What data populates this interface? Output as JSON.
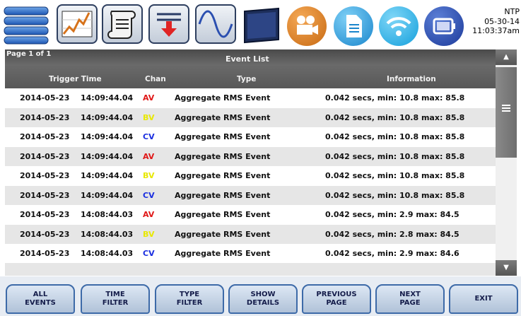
{
  "ntp": {
    "label": "NTP",
    "date": "05-30-14",
    "time": "11:03:37am"
  },
  "toolbar": {
    "icons": [
      "menu-icon",
      "trend-chart-icon",
      "scroll-log-icon",
      "download-icon",
      "waveform-icon",
      "screen-icon",
      "video-camera-icon",
      "document-icon",
      "wireless-icon",
      "battery-icon"
    ]
  },
  "list": {
    "page": "Page 1 of 1",
    "title": "Event List",
    "columns": {
      "trigger_time": "Trigger Time",
      "chan": "Chan",
      "type": "Type",
      "information": "Information"
    },
    "rows": [
      {
        "date": "2014-05-23",
        "time": "14:09:44.04",
        "chan": "AV",
        "type": "Aggregate RMS Event",
        "info": "0.042 secs, min: 10.8 max: 85.8"
      },
      {
        "date": "2014-05-23",
        "time": "14:09:44.04",
        "chan": "BV",
        "type": "Aggregate RMS Event",
        "info": "0.042 secs, min: 10.8 max: 85.8"
      },
      {
        "date": "2014-05-23",
        "time": "14:09:44.04",
        "chan": "CV",
        "type": "Aggregate RMS Event",
        "info": "0.042 secs, min: 10.8 max: 85.8"
      },
      {
        "date": "2014-05-23",
        "time": "14:09:44.04",
        "chan": "AV",
        "type": "Aggregate RMS Event",
        "info": "0.042 secs, min: 10.8 max: 85.8"
      },
      {
        "date": "2014-05-23",
        "time": "14:09:44.04",
        "chan": "BV",
        "type": "Aggregate RMS Event",
        "info": "0.042 secs, min: 10.8 max: 85.8"
      },
      {
        "date": "2014-05-23",
        "time": "14:09:44.04",
        "chan": "CV",
        "type": "Aggregate RMS Event",
        "info": "0.042 secs, min: 10.8 max: 85.8"
      },
      {
        "date": "2014-05-23",
        "time": "14:08:44.03",
        "chan": "AV",
        "type": "Aggregate RMS Event",
        "info": "0.042 secs, min: 2.9 max: 84.5"
      },
      {
        "date": "2014-05-23",
        "time": "14:08:44.03",
        "chan": "BV",
        "type": "Aggregate RMS Event",
        "info": "0.042 secs, min: 2.8 max: 84.5"
      },
      {
        "date": "2014-05-23",
        "time": "14:08:44.03",
        "chan": "CV",
        "type": "Aggregate RMS Event",
        "info": "0.042 secs, min: 2.9 max: 84.6"
      }
    ]
  },
  "chan_colors": {
    "AV": "#e01818",
    "BV": "#e8e800",
    "CV": "#1a2ee0"
  },
  "buttons": [
    {
      "label": "ALL\nEVENTS"
    },
    {
      "label": "TIME\nFILTER"
    },
    {
      "label": "TYPE\nFILTER"
    },
    {
      "label": "SHOW\nDETAILS"
    },
    {
      "label": "PREVIOUS\nPAGE"
    },
    {
      "label": "NEXT\nPAGE"
    },
    {
      "label": "EXIT"
    }
  ]
}
